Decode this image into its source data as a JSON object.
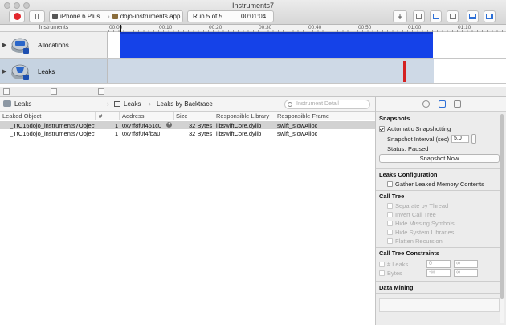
{
  "window": {
    "title": "Instruments7"
  },
  "toolbar": {
    "record_icon": "record-icon",
    "pause_icon": "pause-icon",
    "device": "iPhone 6 Plus...",
    "app": "dojo-instruments.app",
    "run_label": "Run 5 of 5",
    "elapsed": "00:01:04",
    "add_icon": "plus-icon"
  },
  "timeline": {
    "header_label": "Instruments",
    "ticks": [
      "00:00",
      "00:10",
      "00:20",
      "00:30",
      "00:40",
      "00:50",
      "01:00",
      "01:10"
    ]
  },
  "tracks": [
    {
      "name": "Allocations",
      "selected": false
    },
    {
      "name": "Leaks",
      "selected": true
    }
  ],
  "pathbar": {
    "crumb1": "Leaks",
    "crumb2": "Leaks",
    "crumb3": "Leaks by Backtrace",
    "search_placeholder": "Instrument Detail"
  },
  "table": {
    "headers": [
      "Leaked Object",
      "#",
      "Address",
      "Size",
      "Responsible Library",
      "Responsible Frame"
    ],
    "rows": [
      {
        "object": "_TtC16dojo_instruments7Object1",
        "count": "1",
        "address": "0x7ff8f0f461c0",
        "size": "32 Bytes",
        "library": "libswiftCore.dylib",
        "frame": "swift_slowAlloc",
        "selected": true
      },
      {
        "object": "_TtC16dojo_instruments7Object2",
        "count": "1",
        "address": "0x7ff8f0f4fba0",
        "size": "32 Bytes",
        "library": "libswiftCore.dylib",
        "frame": "swift_slowAlloc",
        "selected": false
      }
    ]
  },
  "inspector": {
    "snapshots": {
      "title": "Snapshots",
      "auto_label": "Automatic Snapshotting",
      "auto_checked": true,
      "interval_label": "Snapshot Interval (sec)",
      "interval_value": "5.0",
      "status_label": "Status:",
      "status_value": "Paused",
      "button": "Snapshot Now"
    },
    "leaks_config": {
      "title": "Leaks Configuration",
      "gather_label": "Gather Leaked Memory Contents"
    },
    "call_tree": {
      "title": "Call Tree",
      "options": [
        "Separate by Thread",
        "Invert Call Tree",
        "Hide Missing Symbols",
        "Hide System Libraries",
        "Flatten Recursion"
      ]
    },
    "constraints": {
      "title": "Call Tree Constraints",
      "leaks_label": "# Leaks",
      "leaks_min": "0",
      "leaks_max": "∞",
      "bytes_label": "Bytes",
      "bytes_min": "-∞",
      "bytes_max": "∞"
    },
    "data_mining": {
      "title": "Data Mining"
    }
  }
}
